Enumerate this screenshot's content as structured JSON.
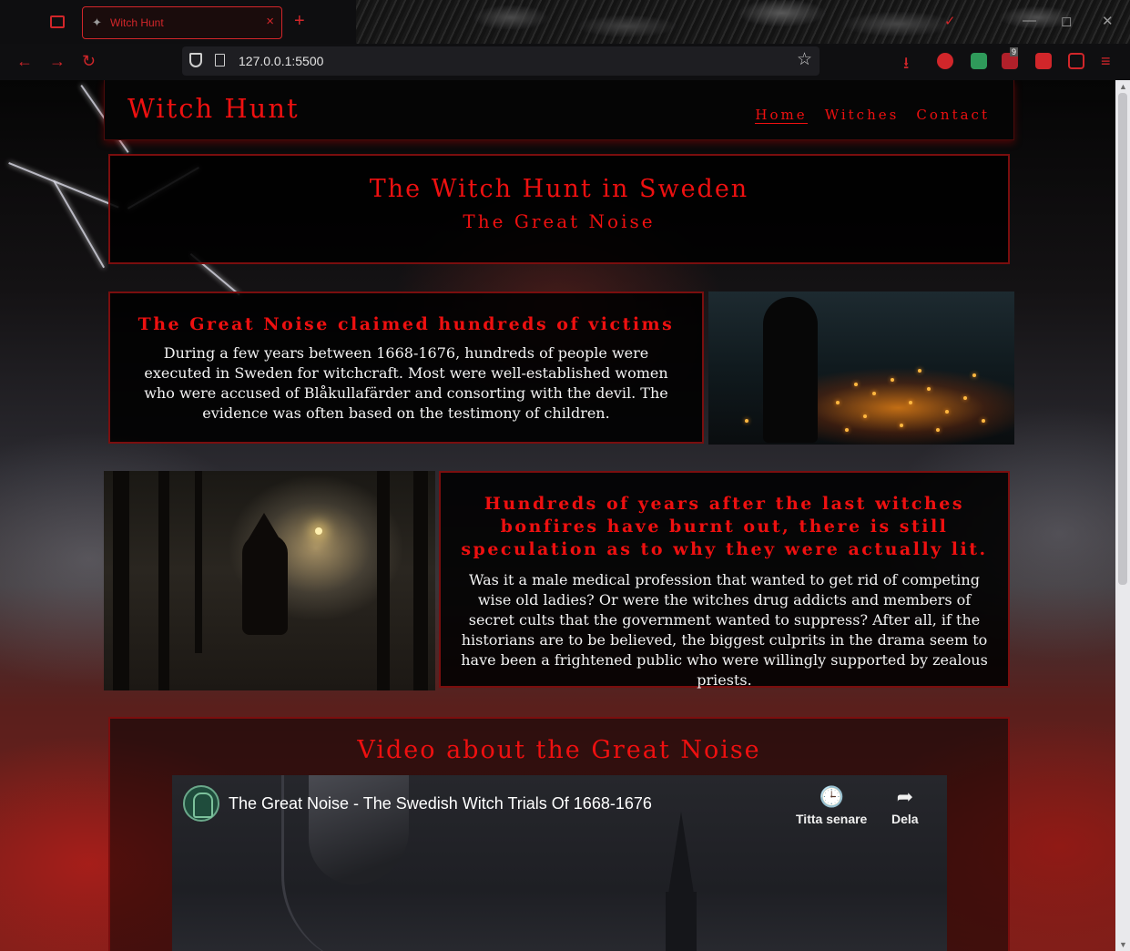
{
  "browser": {
    "tab_title": "Witch Hunt",
    "tab_close": "×",
    "new_tab": "+",
    "url": "127.0.0.1:5500",
    "star": "☆",
    "back": "←",
    "forward": "→",
    "reload": "↻",
    "minimize": "—",
    "maximize": "◻",
    "close": "✕",
    "menu": "≡",
    "download": "⭳",
    "extensions_badge": "9"
  },
  "site": {
    "logo": "Witch Hunt",
    "nav": [
      {
        "label": "Home"
      },
      {
        "label": "Witches"
      },
      {
        "label": "Contact"
      }
    ],
    "hero": {
      "title": "The Witch Hunt in Sweden",
      "subtitle": "The Great Noise"
    },
    "card1": {
      "title": "The Great Noise claimed hundreds of victims",
      "body": "During a few years between 1668-1676, hundreds of people were executed in Sweden for witchcraft. Most were well-established women who were accused of Blåkullafärder and consorting with the devil. The evidence was often based on the testimony of children."
    },
    "card2": {
      "title": "Hundreds of years after the last witches bonfires have burnt out, there is still speculation as to why they were actually lit.",
      "body": "Was it a male medical profession that wanted to get rid of competing wise old ladies? Or were the witches drug addicts and members of secret cults that the government wanted to suppress? After all, if the historians are to be believed, the biggest culprits in the drama seem to have been a frightened public who were willingly supported by zealous priests."
    },
    "video": {
      "heading": "Video about the Great Noise",
      "title": "The Great Noise - The Swedish Witch Trials Of 1668-1676",
      "watch_later": "Titta senare",
      "share": "Dela"
    }
  },
  "colors": {
    "accent": "#ee1010",
    "tab_accent": "#d1262a",
    "panel_border": "#7a0e0e"
  }
}
